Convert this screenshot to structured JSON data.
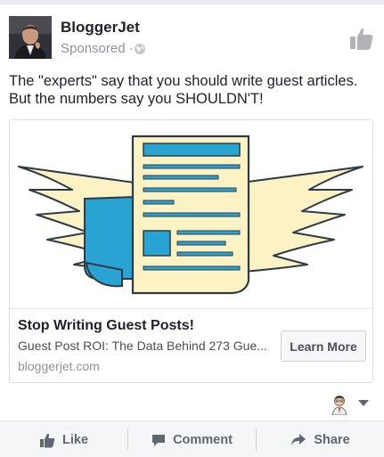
{
  "post": {
    "page_name": "BloggerJet",
    "sponsored_label": "Sponsored",
    "separator": "·",
    "text_line1": "The \"experts\" say that you should write guest articles.",
    "text_line2": "But the numbers say you SHOULDN'T!"
  },
  "link_card": {
    "title": "Stop Writing Guest Posts!",
    "description": "Guest Post ROI: The Data Behind 273 Gue...",
    "domain": "bloggerjet.com",
    "cta_label": "Learn More"
  },
  "actions": {
    "like_label": "Like",
    "comment_label": "Comment",
    "share_label": "Share"
  },
  "icons": {
    "header_like": "thumbs-up-icon",
    "privacy": "globe-icon",
    "menu": "caret-down-icon",
    "like": "thumbs-up-icon",
    "comment": "speech-bubble-icon",
    "share": "share-arrow-icon"
  },
  "colors": {
    "illustration_paper": "#fdf2c4",
    "illustration_blue": "#29a3d1",
    "illustration_outline": "#2e3a45",
    "muted_text": "#90949c",
    "action_bar_bg": "#f5f6f7"
  }
}
